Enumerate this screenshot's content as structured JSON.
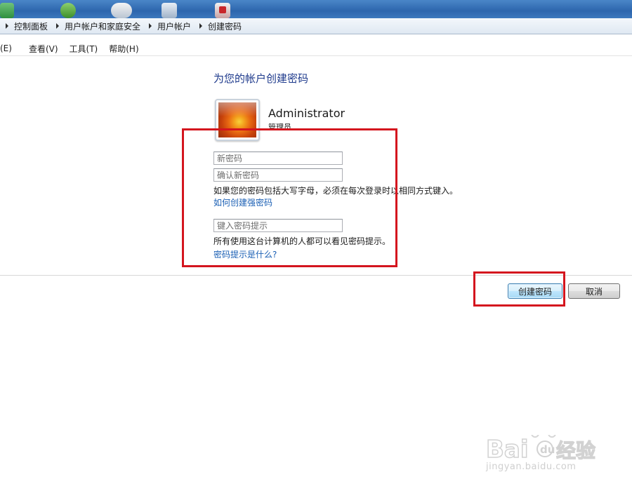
{
  "breadcrumb": {
    "items": [
      "控制面板",
      "用户帐户和家庭安全",
      "用户帐户",
      "创建密码"
    ]
  },
  "menu": {
    "items": [
      "(E)",
      "查看(V)",
      "工具(T)",
      "帮助(H)"
    ]
  },
  "page": {
    "heading": "为您的帐户创建密码"
  },
  "user": {
    "name": "Administrator",
    "role": "管理员"
  },
  "form": {
    "new_password_placeholder": "新密码",
    "confirm_password_placeholder": "确认新密码",
    "case_notice": "如果您的密码包括大写字母，必须在每次登录时以相同方式键入。",
    "strong_password_link": "如何创建强密码",
    "hint_placeholder": "键入密码提示",
    "hint_notice": "所有使用这台计算机的人都可以看见密码提示。",
    "hint_help_link": "密码提示是什么?"
  },
  "buttons": {
    "create": "创建密码",
    "cancel": "取消"
  },
  "watermark": {
    "brand": "Bai",
    "brand_tail": "经验",
    "url": "jingyan.baidu.com"
  },
  "colors": {
    "heading": "#1e3a8c",
    "link": "#1a5fb4",
    "annotation": "#d4151e"
  }
}
